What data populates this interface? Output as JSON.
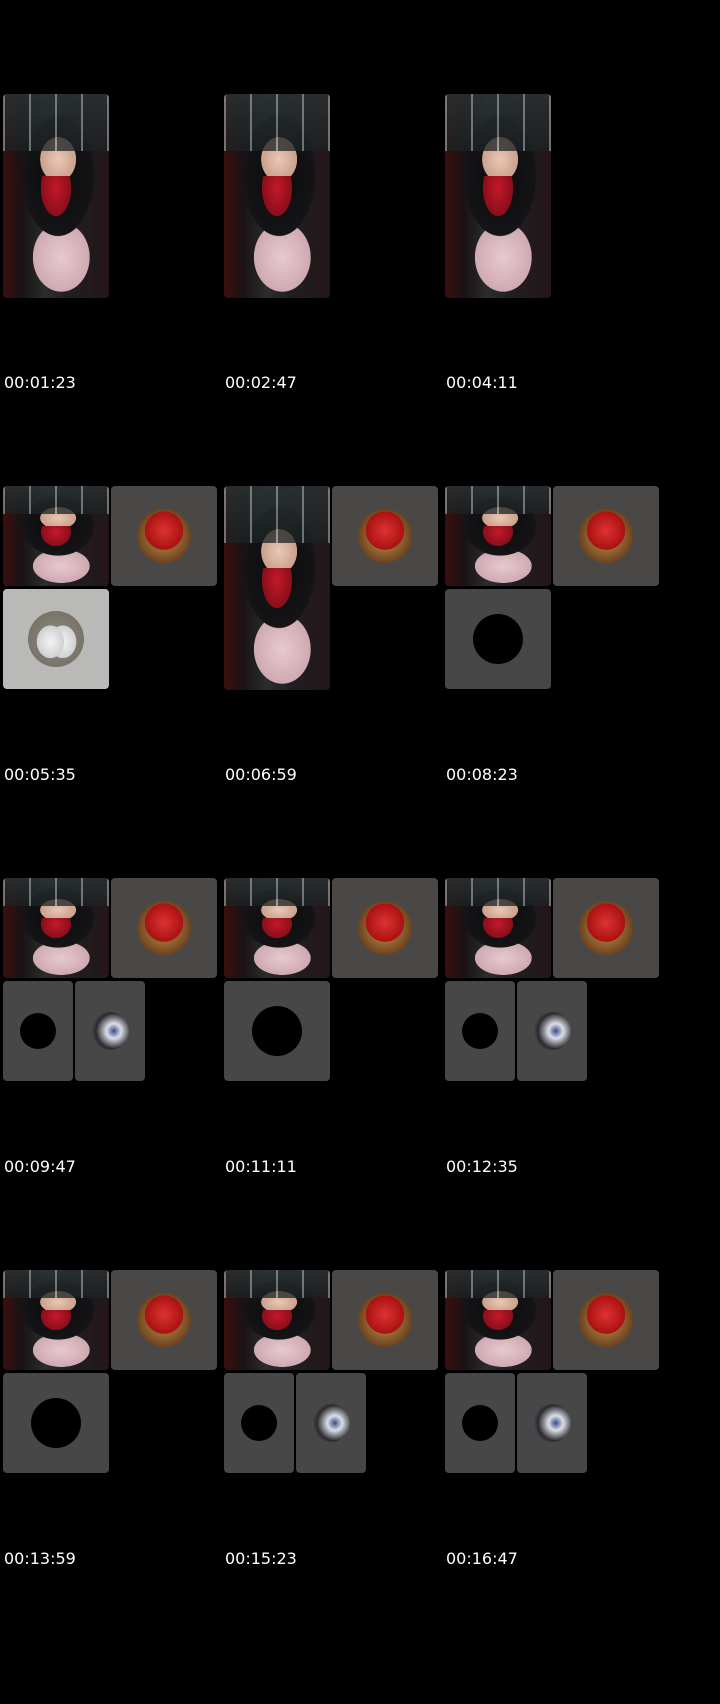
{
  "timestamps": [
    "00:01:23",
    "00:02:47",
    "00:04:11",
    "00:05:35",
    "00:06:59",
    "00:08:23",
    "00:09:47",
    "00:11:11",
    "00:12:35",
    "00:13:59",
    "00:15:23",
    "00:16:47"
  ],
  "colors": {
    "background": "#000000",
    "tile_gray": "#4a4847",
    "text": "#ffffff"
  }
}
